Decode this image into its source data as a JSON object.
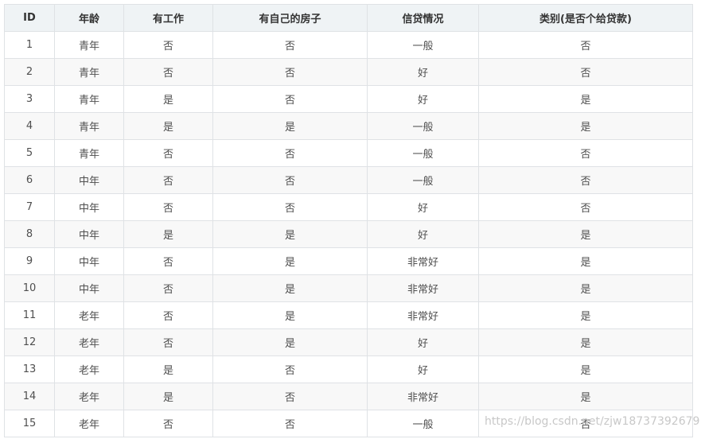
{
  "table": {
    "headers": [
      "ID",
      "年龄",
      "有工作",
      "有自己的房子",
      "信贷情况",
      "类别(是否个给贷款)"
    ],
    "rows": [
      [
        "1",
        "青年",
        "否",
        "否",
        "一般",
        "否"
      ],
      [
        "2",
        "青年",
        "否",
        "否",
        "好",
        "否"
      ],
      [
        "3",
        "青年",
        "是",
        "否",
        "好",
        "是"
      ],
      [
        "4",
        "青年",
        "是",
        "是",
        "一般",
        "是"
      ],
      [
        "5",
        "青年",
        "否",
        "否",
        "一般",
        "否"
      ],
      [
        "6",
        "中年",
        "否",
        "否",
        "一般",
        "否"
      ],
      [
        "7",
        "中年",
        "否",
        "否",
        "好",
        "否"
      ],
      [
        "8",
        "中年",
        "是",
        "是",
        "好",
        "是"
      ],
      [
        "9",
        "中年",
        "否",
        "是",
        "非常好",
        "是"
      ],
      [
        "10",
        "中年",
        "否",
        "是",
        "非常好",
        "是"
      ],
      [
        "11",
        "老年",
        "否",
        "是",
        "非常好",
        "是"
      ],
      [
        "12",
        "老年",
        "否",
        "是",
        "好",
        "是"
      ],
      [
        "13",
        "老年",
        "是",
        "否",
        "好",
        "是"
      ],
      [
        "14",
        "老年",
        "是",
        "否",
        "非常好",
        "是"
      ],
      [
        "15",
        "老年",
        "否",
        "否",
        "一般",
        "否"
      ]
    ]
  },
  "watermark": "https://blog.csdn.net/zjw18737392679"
}
